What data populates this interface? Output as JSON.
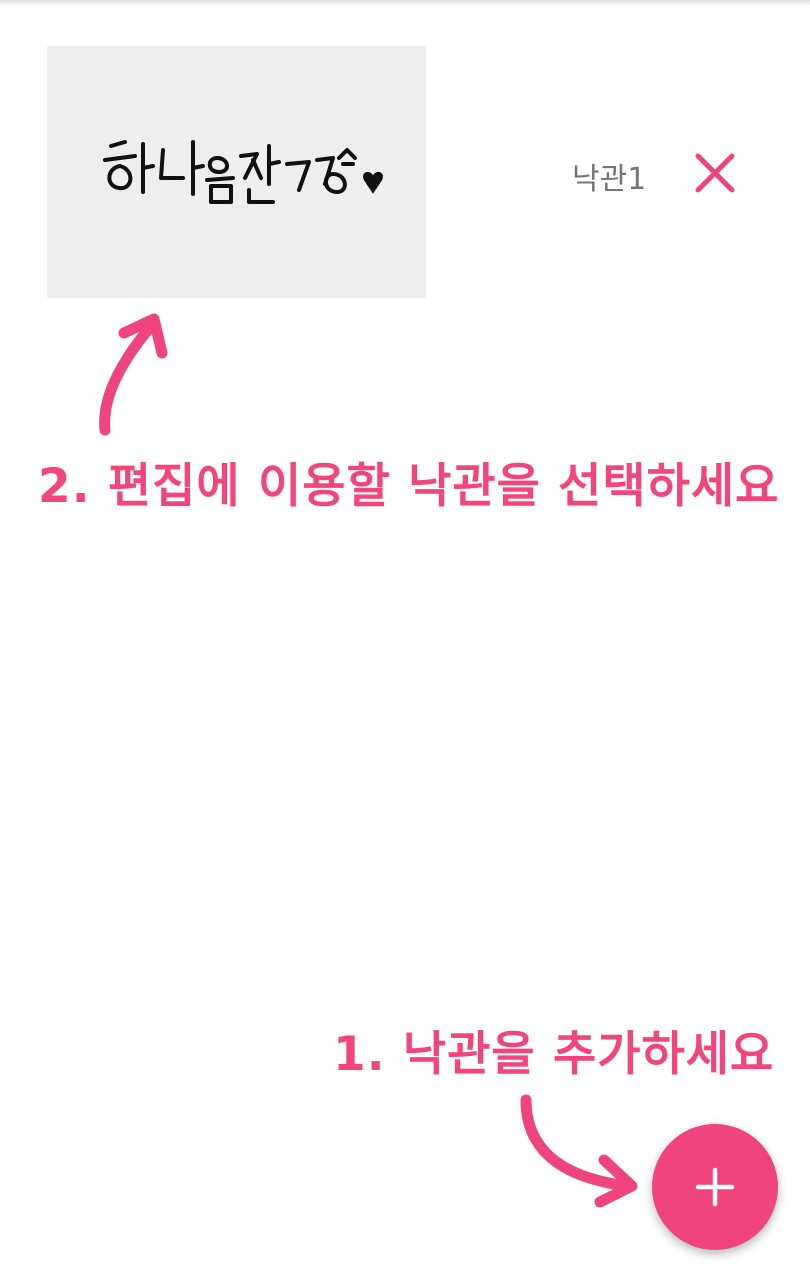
{
  "stamps": [
    {
      "name": "낙관1",
      "handwriting": "하나음짠7강",
      "delete_icon": "close-icon"
    }
  ],
  "hints": {
    "select": "2. 편집에 이용할 낙관을 선택하세요",
    "add": "1. 낙관을 추가하세요"
  },
  "fab": {
    "icon": "plus-icon"
  },
  "colors": {
    "accent": "#f0447e",
    "hint_text": "#f2457e",
    "thumb_bg": "#eeeeee",
    "label_text": "#757575"
  }
}
